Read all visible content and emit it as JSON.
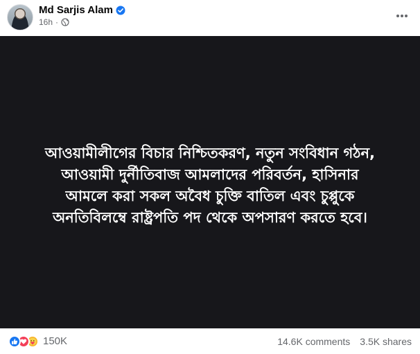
{
  "post": {
    "author": "Md Sarjis Alam",
    "time": "16h",
    "audience_icon": "globe-icon",
    "verified_icon": "verified-badge-icon",
    "more_icon": "more-horizontal-icon",
    "media_text": "আওয়ামীলীগের বিচার নিশ্চিতকরণ, নতুন সংবিধান গঠন,\nআওয়ামী দুর্নীতিবাজ আমলাদের পরিবর্তন, হাসিনার\nআমলে করা সকল অবৈধ চুক্তি বাতিল এবং চুপ্পুকে\nঅনতিবিলম্বে রাষ্ট্রপতি পদ থেকে অপসারণ করতে হবে।",
    "media_background": "#17171b",
    "reactions": {
      "icons": [
        "like-icon",
        "love-icon",
        "care-icon"
      ],
      "count": "150K"
    },
    "comments": "14.6K comments",
    "shares": "3.5K shares"
  },
  "colors": {
    "brand_blue": "#1877f2",
    "secondary_text": "#65676b"
  }
}
